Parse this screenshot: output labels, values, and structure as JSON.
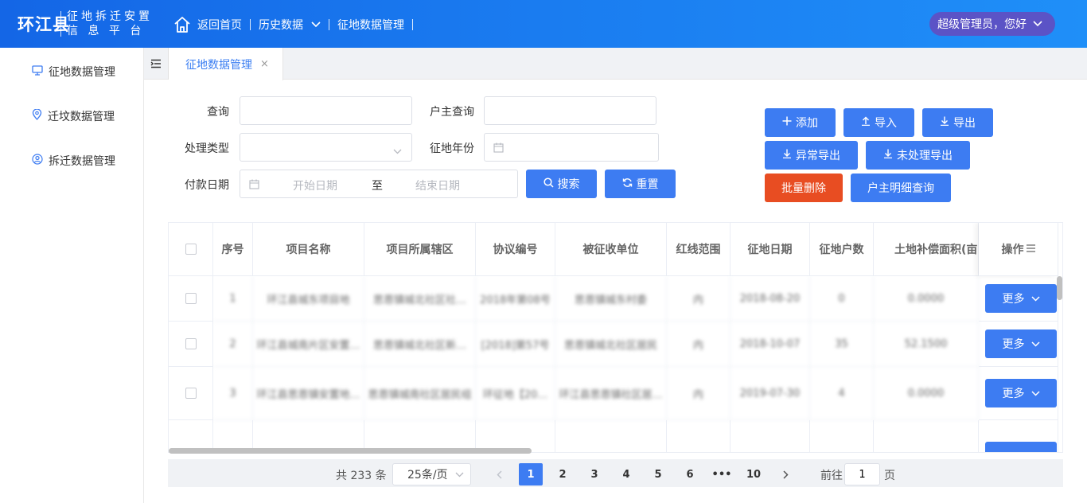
{
  "header": {
    "logo_main": "环江县",
    "logo_line1": "征地拆迁安置",
    "logo_line2": "信 息 平 台",
    "nav": {
      "home": "返回首页",
      "history": "历史数据",
      "land": "征地数据管理"
    },
    "user": "超级管理员，您好"
  },
  "sidebar": {
    "items": [
      {
        "label": "征地数据管理",
        "icon": "monitor-icon"
      },
      {
        "label": "迁坟数据管理",
        "icon": "location-pin-icon"
      },
      {
        "label": "拆迁数据管理",
        "icon": "user-circle-icon"
      }
    ]
  },
  "tabs": [
    {
      "label": "征地数据管理",
      "close": "×"
    }
  ],
  "filters": {
    "query_label": "查询",
    "owner_label": "户主查询",
    "type_label": "处理类型",
    "year_label": "征地年份",
    "date_label": "付款日期",
    "date_start_placeholder": "开始日期",
    "date_to": "至",
    "date_end_placeholder": "结束日期",
    "search": "搜索",
    "reset": "重置"
  },
  "actions": {
    "add": "添加",
    "import": "导入",
    "export": "导出",
    "abnormal_export": "异常导出",
    "unprocessed_export": "未处理导出",
    "batch_delete": "批量删除",
    "owner_detail": "户主明细查询"
  },
  "table": {
    "columns": [
      "序号",
      "项目名称",
      "项目所属辖区",
      "协议编号",
      "被征收单位",
      "红线范围",
      "征地日期",
      "征地户数",
      "土地补偿面积(亩)",
      "操作"
    ],
    "ops_icon": "menu-lines-icon",
    "rows": [
      {
        "no": "1",
        "name": "环江县城东项目地",
        "district": "思恩镇城北社区社…",
        "agreement": "2018年第08号",
        "unit": "思恩镇城东村委",
        "redline": "内",
        "date": "2018-08-20",
        "households": "0",
        "area": "0.0000",
        "more": "更多"
      },
      {
        "no": "2",
        "name": "环江县城南片区安置…",
        "district": "思恩镇城北社区新…",
        "agreement": "[2018]第57号",
        "unit": "思恩镇城北社区居民",
        "redline": "内",
        "date": "2018-10-07",
        "households": "35",
        "area": "52.1500",
        "more": "更多"
      },
      {
        "no": "3",
        "name": "环江县思恩镇安置地…",
        "district": "思恩镇城南社区居民组",
        "agreement": "环征地【20…",
        "unit": "环江县思恩镇社区居…",
        "redline": "内",
        "date": "2019-07-30",
        "households": "4",
        "area": "0.0000",
        "more": "更多"
      }
    ]
  },
  "pagination": {
    "total": "共 233 条",
    "page_size": "25条/页",
    "pages": [
      "1",
      "2",
      "3",
      "4",
      "5",
      "6",
      "•••",
      "10"
    ],
    "current": 1,
    "goto_prefix": "前往",
    "goto_value": "1",
    "goto_suffix": "页"
  },
  "colors": {
    "primary": "#3d7cf2",
    "danger": "#e84d22",
    "header_from": "#1466e6",
    "user_pill": "#5b53c6"
  }
}
